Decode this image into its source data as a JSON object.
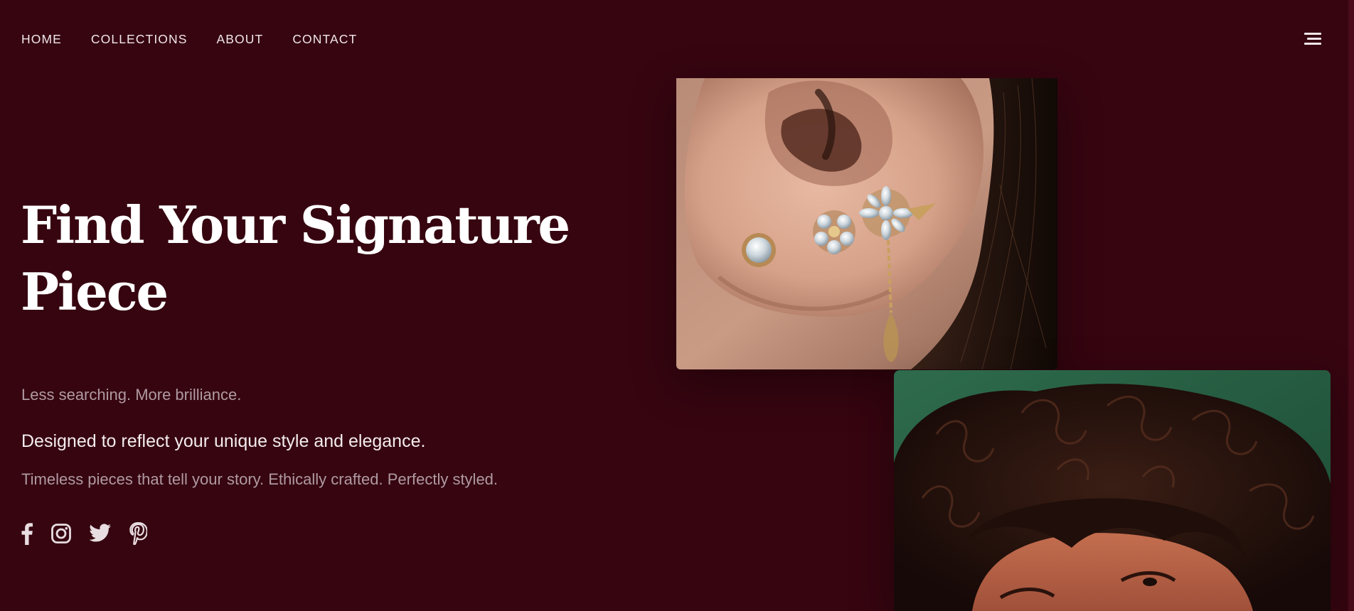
{
  "nav": {
    "items": [
      {
        "label": "HOME"
      },
      {
        "label": "COLLECTIONS"
      },
      {
        "label": "ABOUT"
      },
      {
        "label": "CONTACT"
      }
    ]
  },
  "menu": {
    "icon": "hamburger-menu-icon"
  },
  "hero": {
    "headline_line1": "Find Your Signature",
    "headline_line2": "Piece",
    "tagline": "Less searching. More brilliance.",
    "subheading": "Designed to reflect your unique style and elegance.",
    "description": "Timeless pieces that tell your story. Ethically crafted. Perfectly styled."
  },
  "social": [
    {
      "icon": "facebook-icon"
    },
    {
      "icon": "instagram-icon"
    },
    {
      "icon": "twitter-icon"
    },
    {
      "icon": "pinterest-icon"
    }
  ],
  "images": {
    "ear_photo": {
      "subject": "ear with crystal flower earrings"
    },
    "portrait_photo": {
      "subject": "person with curly dark hair on green background"
    }
  },
  "colors": {
    "background": "#360510",
    "text": "#ffffff",
    "muted_text": "#b09aa2"
  }
}
